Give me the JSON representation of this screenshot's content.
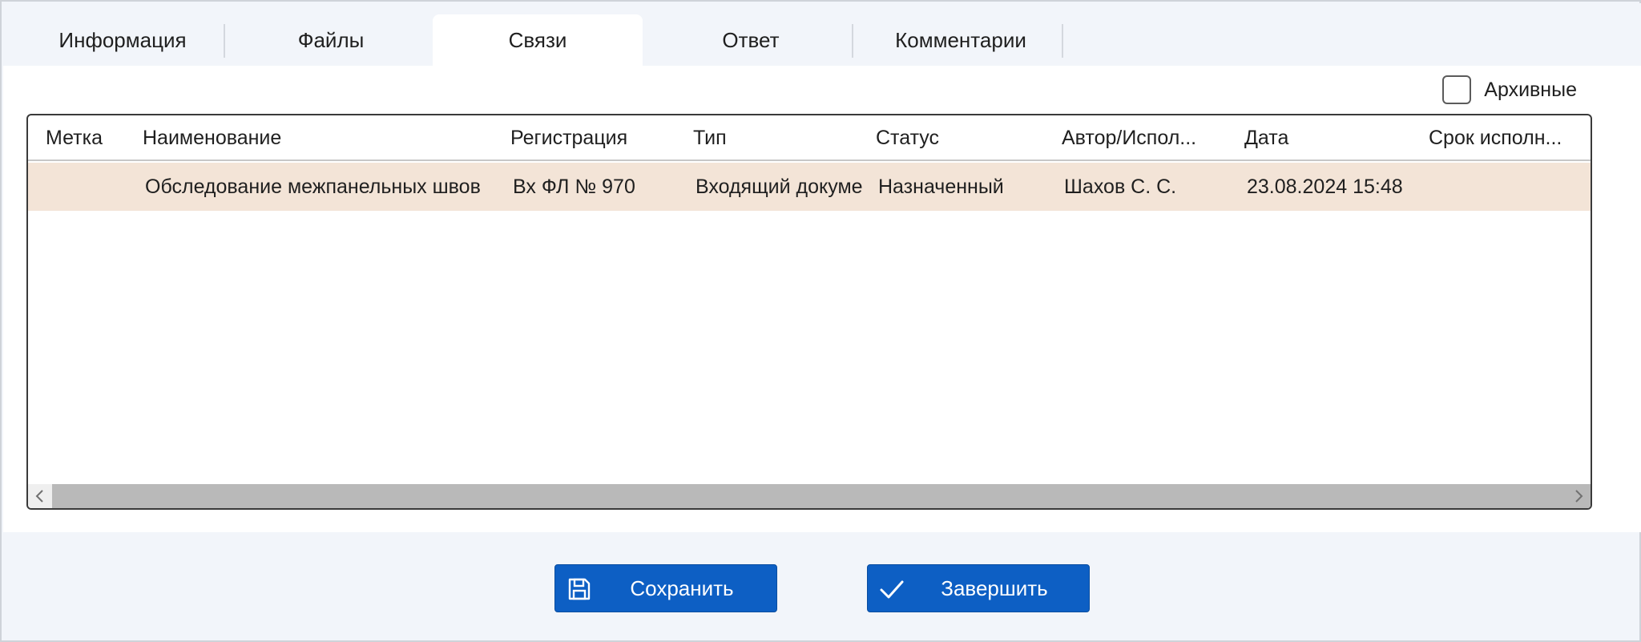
{
  "tabs": [
    {
      "label": "Информация",
      "active": false
    },
    {
      "label": "Файлы",
      "active": false
    },
    {
      "label": "Связи",
      "active": true
    },
    {
      "label": "Ответ",
      "active": false
    },
    {
      "label": "Комментарии",
      "active": false
    }
  ],
  "archive": {
    "label": "Архивные",
    "checked": false
  },
  "table": {
    "columns": [
      "Метка",
      "Наименование",
      "Регистрация",
      "Тип",
      "Статус",
      "Автор/Испол...",
      "Дата",
      "Срок исполн..."
    ],
    "rows": [
      {
        "mark": "",
        "name": "Обследование межпанельных швов",
        "registration": "Вх ФЛ № 970",
        "type": "Входящий документ",
        "status": "Назначенный",
        "author": "Шахов С. С.",
        "date": "23.08.2024 15:48",
        "deadline": ""
      }
    ]
  },
  "buttons": {
    "save": {
      "label": "Сохранить",
      "icon": "save-icon"
    },
    "finish": {
      "label": "Завершить",
      "icon": "checkmark-icon"
    }
  },
  "colors": {
    "accent": "#0d5fc4",
    "selected_row": "#f3e4d7",
    "background": "#f2f5fa"
  }
}
